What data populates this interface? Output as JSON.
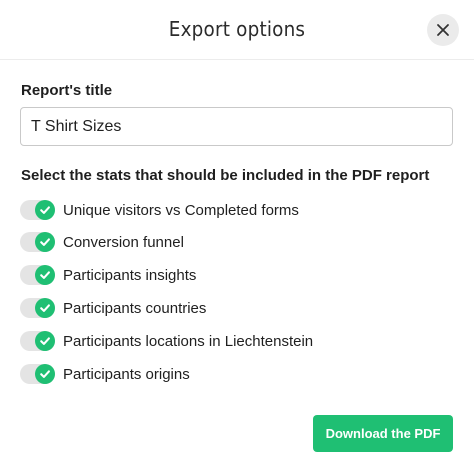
{
  "dialog": {
    "title": "Export options",
    "close_icon": "close-icon"
  },
  "report_title": {
    "label": "Report's title",
    "value": "T Shirt Sizes"
  },
  "stats": {
    "label": "Select the stats that should be included in the PDF report",
    "items": [
      {
        "label": "Unique visitors vs Completed forms",
        "checked": true
      },
      {
        "label": "Conversion funnel",
        "checked": true
      },
      {
        "label": "Participants insights",
        "checked": true
      },
      {
        "label": "Participants countries",
        "checked": true
      },
      {
        "label": "Participants locations in Liechtenstein",
        "checked": true
      },
      {
        "label": "Participants origins",
        "checked": true
      }
    ]
  },
  "actions": {
    "download_label": "Download the PDF"
  },
  "colors": {
    "accent": "#1fbf73",
    "toggle_track": "#e4e4e4",
    "close_bg": "#ebebeb"
  }
}
